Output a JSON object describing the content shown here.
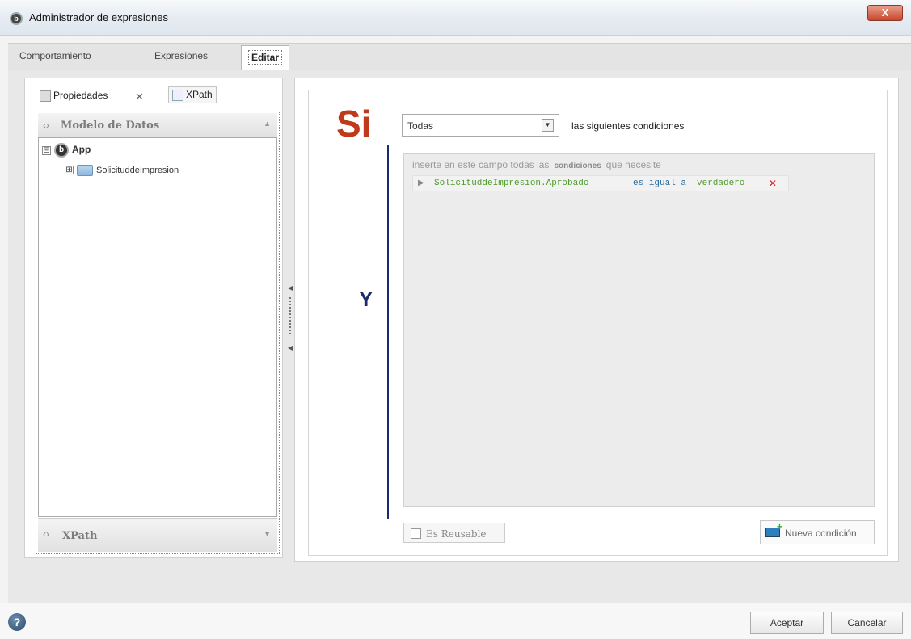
{
  "window": {
    "title": "Administrador de expresiones",
    "close_label": "X"
  },
  "tabs": [
    {
      "label": "Comportamiento"
    },
    {
      "label": "Expresiones"
    },
    {
      "label": "Editar"
    }
  ],
  "left": {
    "tab_properties": "Propiedades",
    "tab_xpath": "XPath",
    "model_header": "Modelo de Datos",
    "tree": [
      {
        "label": "App",
        "expander": "⊟"
      },
      {
        "label": "SolicituddeImpresion",
        "expander": "⊞"
      }
    ],
    "xpath_footer": "XPath"
  },
  "right": {
    "si_label": "Si",
    "select_value": "Todas",
    "siguientes": "las siguientes condiciones",
    "y_label": "Y",
    "hint_pre": "inserte en este campo todas las",
    "hint_bold": "condiciones",
    "hint_post": "que necesite",
    "condition": {
      "field": "SolicituddeImpresion.Aprobado",
      "operator": "es igual a",
      "value": "verdadero"
    },
    "reusable_label": "Es Reusable",
    "new_condition_label": "Nueva condición"
  },
  "footer": {
    "help": "?",
    "accept": "Aceptar",
    "cancel": "Cancelar"
  }
}
